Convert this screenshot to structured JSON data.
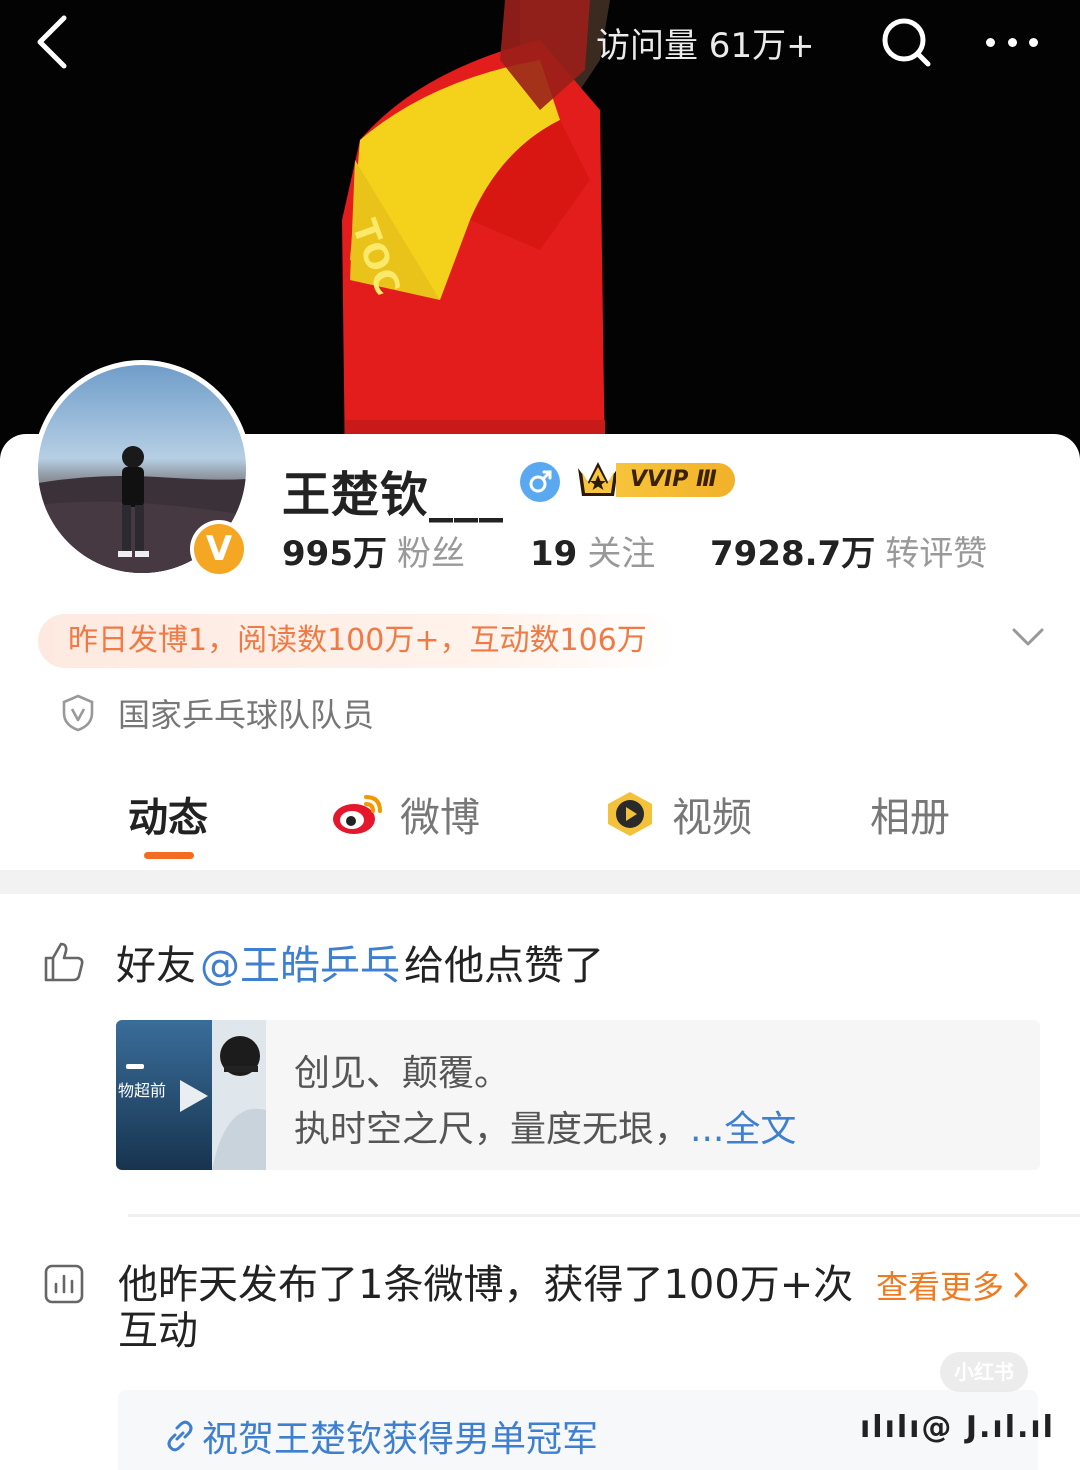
{
  "header": {
    "visits_text": "访问量 61万+",
    "back_icon": "chevron-left-icon",
    "search_icon": "search-icon",
    "more_icon": "more-dots-icon"
  },
  "profile": {
    "name": "王楚钦___",
    "verified_badge": "V",
    "vip_label": "VVIP Ⅲ",
    "stats": [
      {
        "num": "995万",
        "label": "粉丝"
      },
      {
        "num": "19",
        "label": "关注"
      },
      {
        "num": "7928.7万",
        "label": "转评赞"
      }
    ],
    "daily_summary": "昨日发博1，阅读数100万+，互动数106万",
    "certification": "国家乒乓球队队员"
  },
  "tabs": [
    {
      "label": "动态",
      "active": true
    },
    {
      "label": "微博",
      "active": false
    },
    {
      "label": "视频",
      "active": false
    },
    {
      "label": "相册",
      "active": false
    }
  ],
  "feed": {
    "like_item": {
      "prefix": "好友",
      "mention": "@王皓乒乓",
      "suffix": "给他点赞了",
      "card_line1": "创见、颠覆。",
      "card_line2": "执时空之尺，量度无垠，",
      "card_more": "...全文",
      "thumb_text": "物超前"
    },
    "activity_item": {
      "summary": "他昨天发布了1条微博，获得了100万+次互动",
      "view_more": "查看更多",
      "topic": "祝贺王楚钦获得男单冠军"
    }
  },
  "watermark": {
    "logo": "小红书",
    "author": "ılılı@ J.ıl.ıl"
  },
  "colors": {
    "accent_orange": "#f36c21",
    "link_blue": "#3f7fd0",
    "gender_blue": "#5aa8f0",
    "vip_gold": "#f7c43b"
  }
}
